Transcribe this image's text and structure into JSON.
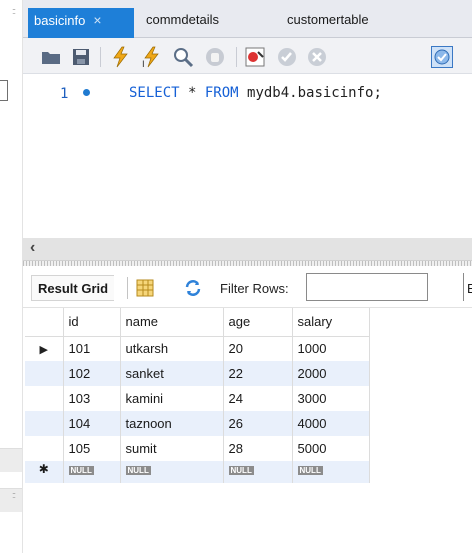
{
  "tabs": [
    {
      "label": "basicinfo",
      "active": true
    },
    {
      "label": "commdetails",
      "active": false
    },
    {
      "label": "customertable",
      "active": false
    }
  ],
  "tab_close_glyph": "×",
  "editor": {
    "line_number": "1",
    "keyword_select": "SELECT",
    "star": " * ",
    "keyword_from": "FROM",
    "rest": " mydb4.basicinfo;"
  },
  "result_toolbar": {
    "result_grid_label": "Result Grid",
    "filter_label": "Filter Rows:",
    "filter_value": "",
    "edge_label": "E"
  },
  "table": {
    "columns": [
      "id",
      "name",
      "age",
      "salary"
    ],
    "rows": [
      [
        "101",
        "utkarsh",
        "20",
        "1000"
      ],
      [
        "102",
        "sanket",
        "22",
        "2000"
      ],
      [
        "103",
        "kamini",
        "24",
        "3000"
      ],
      [
        "104",
        "taznoon",
        "26",
        "4000"
      ],
      [
        "105",
        "sumit",
        "28",
        "5000"
      ]
    ],
    "null_label": "NULL",
    "current_row_marker": "▶",
    "new_row_marker": "✱"
  },
  "colors": {
    "accent": "#1e7fd8",
    "keyword": "#1560d6",
    "alt_row": "#e9f0fb"
  }
}
